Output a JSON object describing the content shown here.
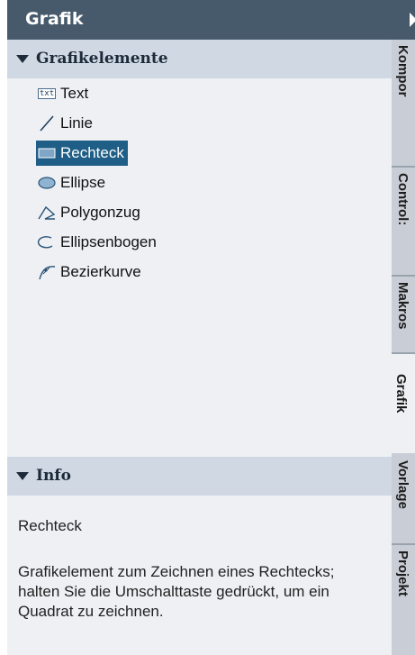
{
  "panel": {
    "title": "Grafik"
  },
  "graphics_section": {
    "label": "Grafikelemente",
    "items": [
      {
        "label": "Text",
        "icon": "text-icon"
      },
      {
        "label": "Linie",
        "icon": "line-icon"
      },
      {
        "label": "Rechteck",
        "icon": "rectangle-icon",
        "selected": true
      },
      {
        "label": "Ellipse",
        "icon": "ellipse-icon"
      },
      {
        "label": "Polygonzug",
        "icon": "polygon-icon"
      },
      {
        "label": "Ellipsenbogen",
        "icon": "ellipse-arc-icon"
      },
      {
        "label": "Bezierkurve",
        "icon": "bezier-icon"
      }
    ]
  },
  "info_section": {
    "label": "Info",
    "title": "Rechteck",
    "description_lines": [
      "Grafikelement zum Zeichnen eines Rechtecks;",
      "halten Sie die Umschalttaste gedrückt, um ein",
      "Quadrat zu zeichnen."
    ]
  },
  "side_tabs": [
    {
      "label": "Kompor"
    },
    {
      "label": "Control:"
    },
    {
      "label": "Makros"
    },
    {
      "label": "Grafik",
      "active": true
    },
    {
      "label": "Vorlage"
    },
    {
      "label": "Projekt"
    }
  ],
  "colors": {
    "header_bg": "#475a6b",
    "section_bg": "#d0d8e3",
    "panel_bg": "#eff0f4",
    "selection_bg": "#1f5e86"
  }
}
